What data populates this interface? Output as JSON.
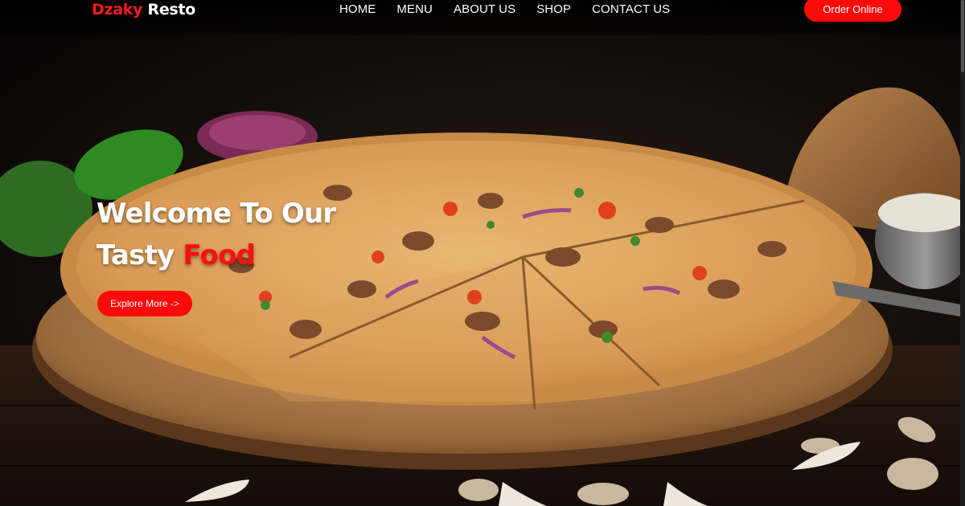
{
  "brand": {
    "name_part1": "Dzaky",
    "name_part2": "Resto",
    "accent_color": "#ff1a1a"
  },
  "nav": {
    "items": [
      "HOME",
      "MENU",
      "ABOUT US",
      "SHOP",
      "CONTACT US"
    ]
  },
  "header": {
    "order_button_label": "Order Online"
  },
  "hero": {
    "headline_line1": "Welcome To Our",
    "headline_line2_plain": "Tasty",
    "headline_line2_accent": "Food",
    "explore_button_label": "Explore More ->",
    "background_image": "pizza-on-wooden-board-photo"
  },
  "colors": {
    "primary_red": "#ff0a0a",
    "background": "#0c0908",
    "text": "#ffffff"
  }
}
